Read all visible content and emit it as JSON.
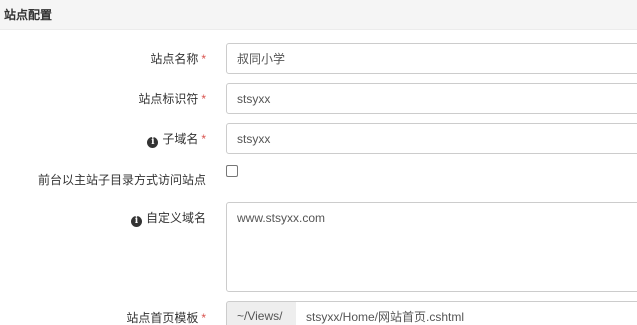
{
  "panel": {
    "title": "站点配置"
  },
  "fields": {
    "site_name": {
      "label": "站点名称",
      "required_mark": "*",
      "value": "叔同小学"
    },
    "site_id": {
      "label": "站点标识符",
      "required_mark": "*",
      "value": "stsyxx"
    },
    "subdomain": {
      "label": "子域名",
      "required_mark": "*",
      "value": "stsyxx"
    },
    "subdir_access": {
      "label": "前台以主站子目录方式访问站点",
      "checked": false
    },
    "custom_domain": {
      "label": "自定义域名",
      "value": "www.stsyxx.com"
    },
    "home_template": {
      "label": "站点首页模板",
      "required_mark": "*",
      "prefix": "~/Views/",
      "value": "stsyxx/Home/网站首页.cshtml"
    }
  },
  "icons": {
    "info": "info-circle-icon"
  },
  "colors": {
    "required": "#d9534f",
    "header_bg": "#f5f5f5",
    "border": "#cccccc",
    "addon_bg": "#eeeeee"
  }
}
